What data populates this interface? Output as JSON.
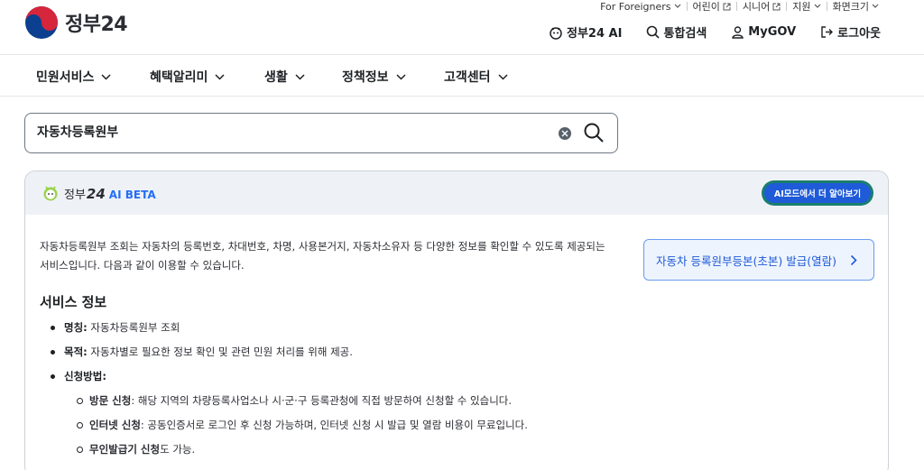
{
  "header": {
    "logo": {
      "text": "정부",
      "num": "24"
    },
    "util_top": [
      {
        "label": "For Foreigners",
        "icon": "chevron-down-icon"
      },
      {
        "label": "어린이",
        "icon": "external-link-icon"
      },
      {
        "label": "시니어",
        "icon": "external-link-icon"
      },
      {
        "label": "지원",
        "icon": "chevron-down-icon"
      },
      {
        "label": "화면크기",
        "icon": "chevron-down-icon"
      }
    ],
    "util_main": [
      {
        "label": "정부24 AI",
        "icon": "ai-mascot-icon"
      },
      {
        "label": "통합검색",
        "icon": "search-icon"
      },
      {
        "label": "MyGOV",
        "icon": "user-icon"
      },
      {
        "label": "로그아웃",
        "icon": "logout-icon"
      }
    ]
  },
  "gnb": [
    {
      "label": "민원서비스"
    },
    {
      "label": "혜택알리미"
    },
    {
      "label": "생활"
    },
    {
      "label": "정책정보"
    },
    {
      "label": "고객센터"
    }
  ],
  "search": {
    "value": "자동차등록원부"
  },
  "ai": {
    "brand_text": "정부",
    "brand_num": "24",
    "beta_label": "AI BETA",
    "mode_button": "AI모드에서 더 알아보기",
    "summary": "자동차등록원부 조회는 자동차의 등록번호, 차대번호, 차명, 사용본거지, 자동차소유자 등 다양한 정보를 확인할 수 있도록 제공되는 서비스입니다. 다음과 같이 이용할 수 있습니다.",
    "doc_button": "자동차 등록원부등본(초본) 발급(열람)",
    "section_title": "서비스 정보",
    "items": [
      {
        "term": "명칭:",
        "desc": " 자동차등록원부 조회"
      },
      {
        "term": "목적:",
        "desc": " 자동차별로 필요한 정보 확인 및 관련 민원 처리를 위해 제공."
      },
      {
        "term": "신청방법:",
        "desc": ""
      }
    ],
    "sub_items": [
      {
        "term": "방문 신청",
        "desc": ": 해당 지역의 차량등록사업소나 시·군·구 등록관청에 직접 방문하여 신청할 수 있습니다."
      },
      {
        "term": "인터넷 신청",
        "desc": ": 공동인증서로 로그인 후 신청 가능하며, 인터넷 신청 시 발급 및 열람 비용이 무료입니다."
      },
      {
        "term": "무인발급기 신청",
        "desc": "도 가능."
      }
    ]
  },
  "colors": {
    "brand_blue": "#256ef4",
    "ai_button_green": "#1a7e6e",
    "ai_button_blue": "#1f5bd8",
    "panel_head_bg": "#eef2f7"
  }
}
